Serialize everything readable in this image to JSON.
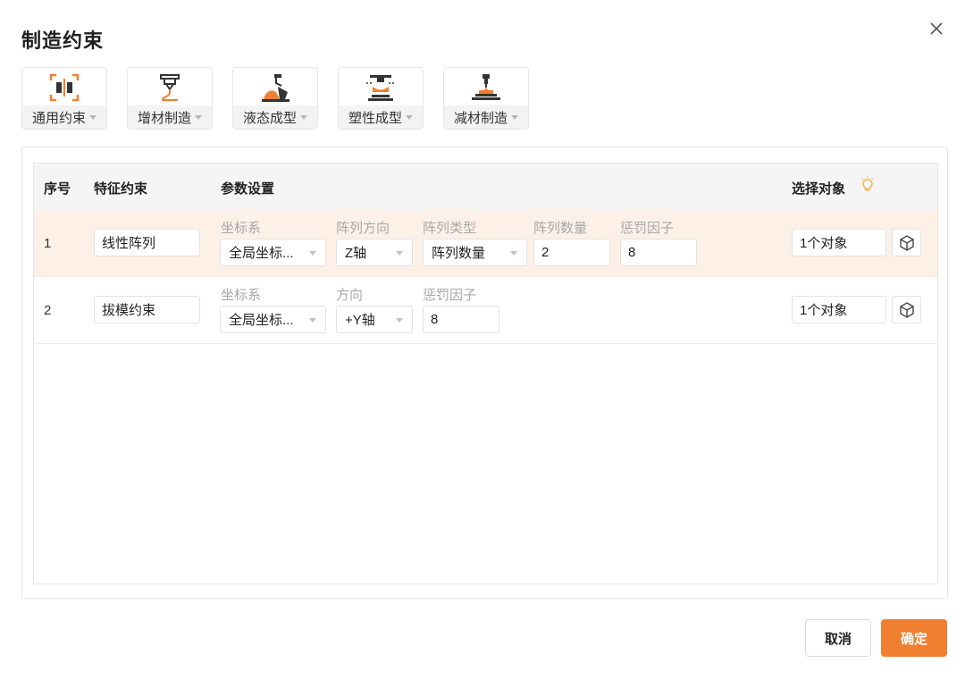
{
  "dialog": {
    "title": "制造约束",
    "cancel_label": "取消",
    "ok_label": "确定"
  },
  "tools": [
    {
      "label": "通用约束",
      "icon": "general-constraint-icon"
    },
    {
      "label": "增材制造",
      "icon": "additive-manufacturing-icon"
    },
    {
      "label": "液态成型",
      "icon": "liquid-forming-icon"
    },
    {
      "label": "塑性成型",
      "icon": "plastic-forming-icon"
    },
    {
      "label": "减材制造",
      "icon": "subtractive-manufacturing-icon"
    }
  ],
  "table": {
    "headers": {
      "index": "序号",
      "feature": "特征约束",
      "params": "参数设置",
      "target": "选择对象"
    },
    "rows": [
      {
        "index": "1",
        "feature": "线性阵列",
        "selected": true,
        "params": {
          "coord_label": "坐标系",
          "coord_value": "全局坐标...",
          "dir_label": "阵列方向",
          "dir_value": "Z轴",
          "type_label": "阵列类型",
          "type_value": "阵列数量",
          "count_label": "阵列数量",
          "count_value": "2",
          "penalty_label": "惩罚因子",
          "penalty_value": "8"
        },
        "target": "1个对象"
      },
      {
        "index": "2",
        "feature": "拔模约束",
        "selected": false,
        "params": {
          "coord_label": "坐标系",
          "coord_value": "全局坐标...",
          "dir_label": "方向",
          "dir_value": "+Y轴",
          "penalty_label": "惩罚因子",
          "penalty_value": "8"
        },
        "target": "1个对象"
      }
    ]
  },
  "colors": {
    "accent": "#f07f30",
    "selected_row": "#fdf1e7",
    "header_bg": "#f5f5f5"
  }
}
